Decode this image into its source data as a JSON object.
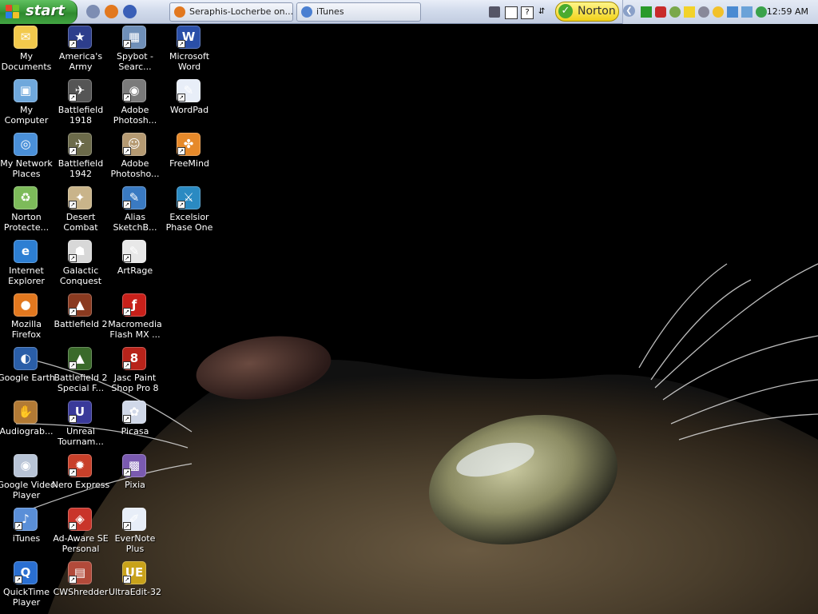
{
  "taskbar": {
    "start_label": "start",
    "quick_launch": [
      {
        "icon": "show-desktop-icon",
        "color": "#7d8db3"
      },
      {
        "icon": "firefox-icon",
        "color": "#e2781f"
      },
      {
        "icon": "media-player-icon",
        "color": "#3a5fb7"
      }
    ],
    "tasks": [
      {
        "label": "Seraphis-Locherbe on...",
        "icon": "firefox-icon",
        "color": "#e2781f"
      },
      {
        "label": "iTunes",
        "icon": "itunes-icon",
        "color": "#4a7fd1"
      }
    ],
    "norton_label": "Norton",
    "tray_clock": "12:59 AM"
  },
  "desktop": {
    "columns": [
      [
        {
          "label": "My\nDocuments",
          "icon": "my-documents-icon",
          "color": "#f2c94c",
          "glyph": "✉",
          "shortcut": false
        },
        {
          "label": "My Computer",
          "icon": "my-computer-icon",
          "color": "#6fa8dc",
          "glyph": "▣",
          "shortcut": false
        },
        {
          "label": "My Network\nPlaces",
          "icon": "network-places-icon",
          "color": "#4a90d9",
          "glyph": "◎",
          "shortcut": false
        },
        {
          "label": "Norton\nProtecte...",
          "icon": "recycle-bin-icon",
          "color": "#7dbb5a",
          "glyph": "♻",
          "shortcut": false
        },
        {
          "label": "Internet\nExplorer",
          "icon": "internet-explorer-icon",
          "color": "#2d7fd3",
          "glyph": "e",
          "shortcut": false
        },
        {
          "label": "Mozilla\nFirefox",
          "icon": "firefox-icon",
          "color": "#e2781f",
          "glyph": "●",
          "shortcut": false
        },
        {
          "label": "Google Earth",
          "icon": "google-earth-icon",
          "color": "#2a5ea8",
          "glyph": "◐",
          "shortcut": false
        },
        {
          "label": "Audiograb...",
          "icon": "audiograbber-icon",
          "color": "#b27a35",
          "glyph": "✋",
          "shortcut": false
        },
        {
          "label": "Google Video\nPlayer",
          "icon": "google-video-icon",
          "color": "#b8c4d6",
          "glyph": "◉",
          "shortcut": false
        },
        {
          "label": "iTunes",
          "icon": "itunes-icon",
          "color": "#5a8fd8",
          "glyph": "♪",
          "shortcut": true
        },
        {
          "label": "QuickTime\nPlayer",
          "icon": "quicktime-icon",
          "color": "#2a6fd1",
          "glyph": "Q",
          "shortcut": true
        }
      ],
      [
        {
          "label": "America's\nArmy",
          "icon": "americas-army-icon",
          "color": "#2d3e8c",
          "glyph": "★",
          "shortcut": true
        },
        {
          "label": "Battlefield\n1918",
          "icon": "battlefield-icon",
          "color": "#555555",
          "glyph": "✈",
          "shortcut": true
        },
        {
          "label": "Battlefield\n1942",
          "icon": "battlefield-icon",
          "color": "#6c6b4a",
          "glyph": "✈",
          "shortcut": true
        },
        {
          "label": "Desert\nCombat",
          "icon": "desert-combat-icon",
          "color": "#c9b48a",
          "glyph": "✦",
          "shortcut": true
        },
        {
          "label": "Galactic\nConquest",
          "icon": "stormtrooper-icon",
          "color": "#d8d8d8",
          "glyph": "☗",
          "shortcut": true
        },
        {
          "label": "Battlefield 2",
          "icon": "battlefield-icon",
          "color": "#8a3a20",
          "glyph": "▲",
          "shortcut": true
        },
        {
          "label": "Battlefield 2\nSpecial F...",
          "icon": "battlefield-icon",
          "color": "#3a6a2a",
          "glyph": "▲",
          "shortcut": true
        },
        {
          "label": "Unreal\nTournam...",
          "icon": "unreal-icon",
          "color": "#3a3a9a",
          "glyph": "U",
          "shortcut": true
        },
        {
          "label": "Nero Express",
          "icon": "nero-icon",
          "color": "#c8402a",
          "glyph": "✹",
          "shortcut": true
        },
        {
          "label": "Ad-Aware SE\nPersonal",
          "icon": "ad-aware-icon",
          "color": "#c9342a",
          "glyph": "◈",
          "shortcut": true
        },
        {
          "label": "CWShredder",
          "icon": "cwshredder-icon",
          "color": "#b24a3a",
          "glyph": "▤",
          "shortcut": true
        }
      ],
      [
        {
          "label": "Spybot -\nSearc...",
          "icon": "spybot-icon",
          "color": "#6f8fb8",
          "glyph": "▦",
          "shortcut": true
        },
        {
          "label": "Adobe\nPhotosh...",
          "icon": "photoshop-icon",
          "color": "#7a7a7a",
          "glyph": "◉",
          "shortcut": true
        },
        {
          "label": "Adobe\nPhotosho...",
          "icon": "photoshop-album-icon",
          "color": "#b59a72",
          "glyph": "☺",
          "shortcut": true
        },
        {
          "label": "Alias\nSketchB...",
          "icon": "sketchbook-icon",
          "color": "#3a7ac2",
          "glyph": "✎",
          "shortcut": true
        },
        {
          "label": "ArtRage",
          "icon": "artrage-icon",
          "color": "#e8e8e8",
          "glyph": "✎",
          "shortcut": true
        },
        {
          "label": "Macromedia\nFlash MX ...",
          "icon": "flash-icon",
          "color": "#c8201a",
          "glyph": "ƒ",
          "shortcut": true
        },
        {
          "label": "Jasc Paint\nShop Pro 8",
          "icon": "paint-shop-pro-icon",
          "color": "#b8231a",
          "glyph": "8",
          "shortcut": true
        },
        {
          "label": "Picasa",
          "icon": "picasa-icon",
          "color": "#d0d8e8",
          "glyph": "✿",
          "shortcut": true
        },
        {
          "label": "Pixia",
          "icon": "pixia-icon",
          "color": "#7a5ab0",
          "glyph": "▩",
          "shortcut": true
        },
        {
          "label": "EverNote\nPlus",
          "icon": "evernote-icon",
          "color": "#e8eef8",
          "glyph": "✐",
          "shortcut": true
        },
        {
          "label": "UltraEdit-32",
          "icon": "ultraedit-icon",
          "color": "#c8a21a",
          "glyph": "UE",
          "shortcut": true
        }
      ],
      [
        {
          "label": "Microsoft\nWord",
          "icon": "word-icon",
          "color": "#2a4fa8",
          "glyph": "W",
          "shortcut": true
        },
        {
          "label": "WordPad",
          "icon": "wordpad-icon",
          "color": "#e8eef8",
          "glyph": "✎",
          "shortcut": true
        },
        {
          "label": "FreeMind",
          "icon": "freemind-icon",
          "color": "#e6892a",
          "glyph": "✤",
          "shortcut": true
        },
        {
          "label": "Excelsior\nPhase One",
          "icon": "excelsior-icon",
          "color": "#2a8ac2",
          "glyph": "⚔",
          "shortcut": true
        }
      ]
    ]
  }
}
